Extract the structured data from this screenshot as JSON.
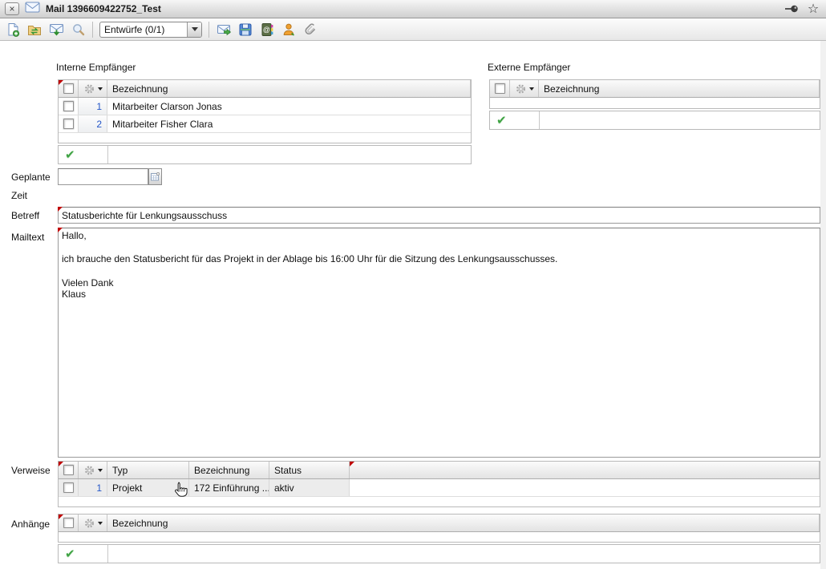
{
  "window": {
    "title": "Mail 1396609422752_Test",
    "titlebar_icons": [
      "close-icon",
      "mail-icon",
      "pushpin-icon",
      "favorite-star-icon"
    ]
  },
  "toolbar": {
    "folder_dropdown": {
      "value": "Entwürfe (0/1)"
    },
    "icons": [
      "new-mail-icon",
      "sync-folder-icon",
      "fetch-mail-icon",
      "search-icon",
      "send-mail-icon",
      "save-icon",
      "address-book-icon",
      "user-icon",
      "attachment-icon"
    ]
  },
  "interne": {
    "label": "Interne Empfänger",
    "col_bezeichnung": "Bezeichnung",
    "rows": [
      {
        "num": "1",
        "bezeichnung": "Mitarbeiter Clarson Jonas"
      },
      {
        "num": "2",
        "bezeichnung": "Mitarbeiter Fisher Clara"
      }
    ],
    "new_entry_value": ""
  },
  "externe": {
    "label": "Externe Empfänger",
    "col_bezeichnung": "Bezeichnung",
    "rows": [],
    "new_entry_value": ""
  },
  "geplante_zeit": {
    "label_line1": "Geplante",
    "label_line2": "Zeit",
    "value": ""
  },
  "betreff": {
    "label": "Betreff",
    "value": "Statusberichte für Lenkungsausschuss"
  },
  "mailtext": {
    "label": "Mailtext",
    "value": "Hallo,\n\nich brauche den Statusbericht für das Projekt in der Ablage bis 16:00 Uhr für die Sitzung des Lenkungsausschusses.\n\nVielen Dank\nKlaus"
  },
  "verweise": {
    "label": "Verweise",
    "col_typ": "Typ",
    "col_bezeichnung": "Bezeichnung",
    "col_status": "Status",
    "rows": [
      {
        "num": "1",
        "typ": "Projekt",
        "bezeichnung": "172 Einführung ...",
        "status": "aktiv"
      }
    ]
  },
  "anhaenge": {
    "label": "Anhänge",
    "col_bezeichnung": "Bezeichnung",
    "rows": [],
    "new_entry_value": ""
  },
  "colors": {
    "accent_number_blue": "#2456c8",
    "required_marker_red": "#c00000",
    "confirm_check_green": "#3fa343"
  }
}
